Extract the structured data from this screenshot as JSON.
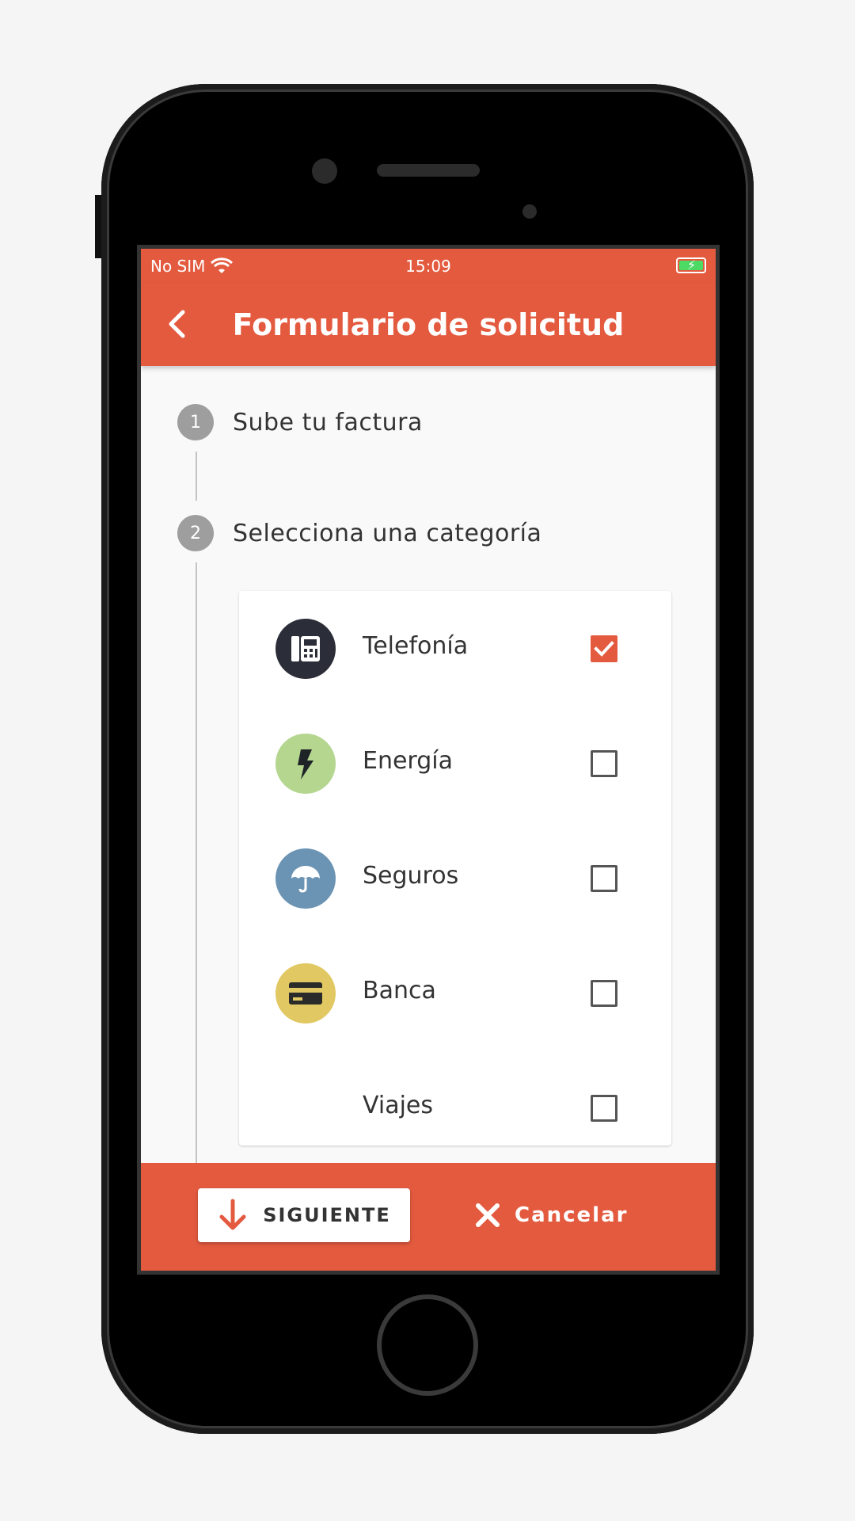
{
  "status_bar": {
    "carrier": "No SIM",
    "time": "15:09"
  },
  "app_bar": {
    "title": "Formulario de solicitud"
  },
  "steps": [
    {
      "number": "1",
      "label": "Sube tu factura"
    },
    {
      "number": "2",
      "label": "Selecciona una categoría"
    }
  ],
  "categories": [
    {
      "label": "Telefonía",
      "icon": "phone-icon",
      "icon_bg": "#2b2e38",
      "checked": true
    },
    {
      "label": "Energía",
      "icon": "lightning-icon",
      "icon_bg": "#b4d68f",
      "checked": false
    },
    {
      "label": "Seguros",
      "icon": "umbrella-icon",
      "icon_bg": "#6b94b4",
      "checked": false
    },
    {
      "label": "Banca",
      "icon": "credit-card-icon",
      "icon_bg": "#e1c862",
      "checked": false
    },
    {
      "label": "Viajes",
      "icon": "",
      "checked": false
    }
  ],
  "bottom_bar": {
    "next_label": "SIGUIENTE",
    "cancel_label": "Cancelar"
  },
  "colors": {
    "accent": "#e35a3f",
    "step_circle": "#9e9e9e"
  }
}
